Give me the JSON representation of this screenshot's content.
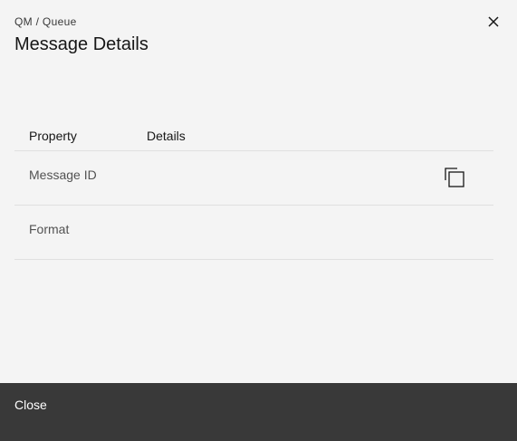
{
  "modal": {
    "breadcrumb": "QM / Queue",
    "title": "Message Details",
    "close_icon": "close-icon"
  },
  "table": {
    "headers": [
      "Property",
      "Details"
    ],
    "rows": [
      {
        "label": "Message ID",
        "value": "",
        "copy_icon": "copy-icon"
      },
      {
        "label": "Format",
        "value": ""
      }
    ]
  },
  "footer": {
    "close_label": "Close",
    "background": "#393939"
  }
}
